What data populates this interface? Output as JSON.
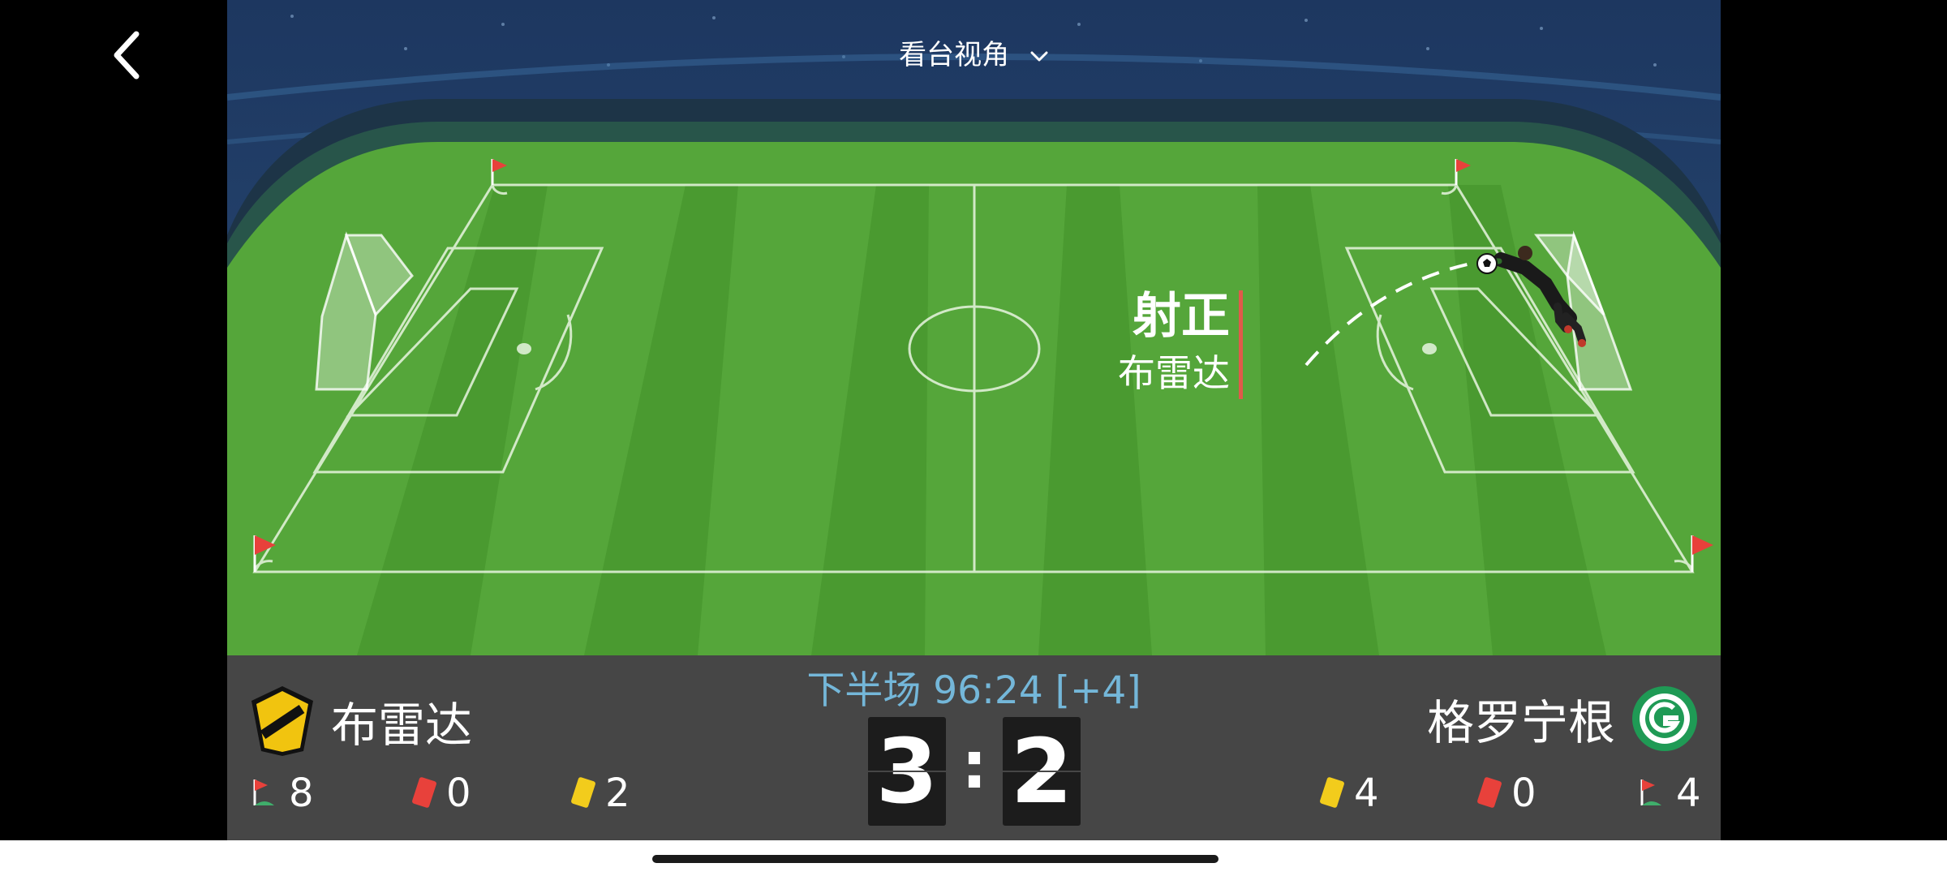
{
  "view_selector": {
    "label": "看台视角",
    "icon": "chevron-down-icon"
  },
  "event": {
    "type": "射正",
    "team": "布雷达"
  },
  "match": {
    "period_time": "下半场 96:24 [+4]"
  },
  "home": {
    "name": "布雷达",
    "score": "3",
    "stats": {
      "corners": "8",
      "red_cards": "0",
      "yellow_cards": "2"
    }
  },
  "away": {
    "name": "格罗宁根",
    "score": "2",
    "stats": {
      "yellow_cards": "4",
      "red_cards": "0",
      "corners": "4"
    }
  },
  "score_separator": ":",
  "colors": {
    "pitch_light": "#5aaa3c",
    "pitch_dark": "#4c9a30",
    "scoreboard_bg": "#464646",
    "time_text": "#74b7d9",
    "event_bar": "#e05a4a",
    "red_card": "#e8413b",
    "yellow_card": "#f2cc1c",
    "away_badge": "#1f9a55",
    "home_badge": "#f1c40f"
  }
}
